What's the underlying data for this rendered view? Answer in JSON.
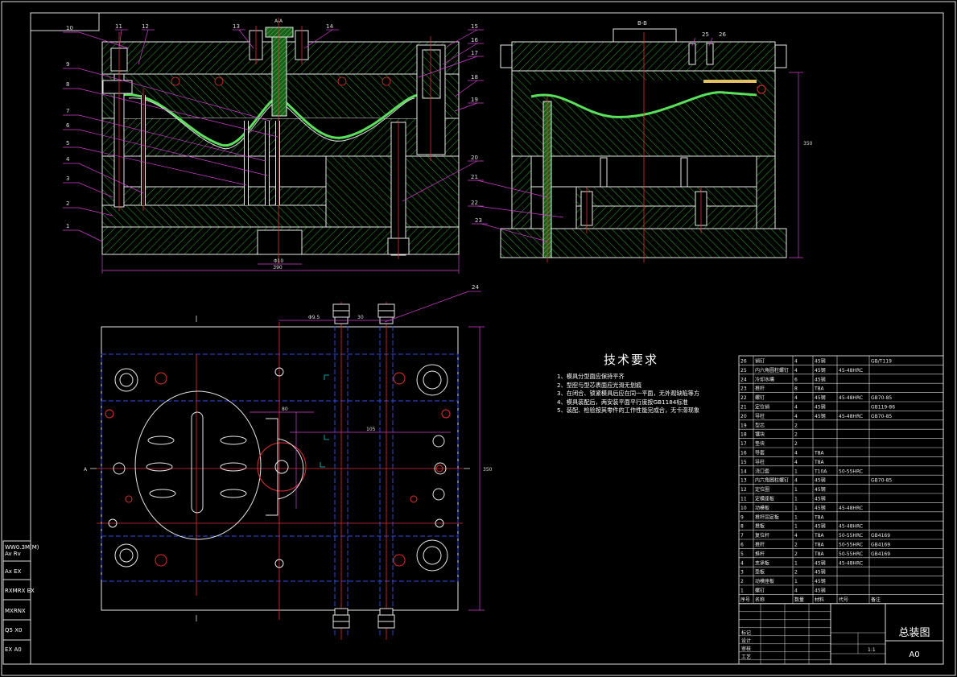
{
  "section_labels": {
    "section_a": "A-A",
    "section_b": "B-B",
    "view_a": "A"
  },
  "callouts_left": [
    "10",
    "9",
    "8",
    "7",
    "6",
    "5",
    "4",
    "3",
    "2",
    "1"
  ],
  "callouts_top": [
    "11",
    "12",
    "13",
    "14"
  ],
  "callouts_right": [
    "15",
    "16",
    "17",
    "18",
    "19",
    "20",
    "21",
    "22",
    "23"
  ],
  "callouts_bb": [
    "25",
    "26"
  ],
  "callout_plan": "24",
  "dims": {
    "overall_width": "390",
    "inner_width": "Φ10",
    "bb_height": "350",
    "plan_height": "350",
    "plan_w1": "Φ9.5",
    "plan_w2": "30",
    "plan_w3": "105",
    "plan_w4": "120",
    "plan_w5": "80"
  },
  "technical_requirements": {
    "title": "技术要求",
    "items": [
      "1、模具分型面应保持平齐",
      "2、型腔与型芯表面应光滑无划痕",
      "3、在闭合、锁紧模具后应在同一平面，无外观缺陷等方",
      "4、模具装配后，两安装平面平行度按GB1184标准",
      "5、装配、检验按其零件的工作性能完成合，无卡滞现象"
    ]
  },
  "bom": {
    "rows": [
      [
        "26",
        "销钉",
        "4",
        "45钢",
        "",
        "GB/T119"
      ],
      [
        "25",
        "内六角圆柱螺钉",
        "4",
        "45钢",
        "45-48HRC",
        ""
      ],
      [
        "24",
        "冷却水嘴",
        "6",
        "45钢",
        "",
        ""
      ],
      [
        "23",
        "推杆",
        "8",
        "T8A",
        "",
        ""
      ],
      [
        "22",
        "螺钉",
        "4",
        "45钢",
        "45-48HRC",
        "GB70-85"
      ],
      [
        "21",
        "定位销",
        "4",
        "45钢",
        "",
        "GB119-86"
      ],
      [
        "20",
        "导柱",
        "4",
        "45钢",
        "45-48HRC",
        "GB70-85"
      ],
      [
        "19",
        "型芯",
        "2",
        "",
        "",
        ""
      ],
      [
        "18",
        "镶块",
        "2",
        "",
        "",
        ""
      ],
      [
        "17",
        "垫块",
        "2",
        "",
        "",
        ""
      ],
      [
        "16",
        "导套",
        "4",
        "T8A",
        "",
        ""
      ],
      [
        "15",
        "导柱",
        "4",
        "T8A",
        "",
        ""
      ],
      [
        "14",
        "浇口套",
        "1",
        "T10A",
        "50-55HRC",
        ""
      ],
      [
        "13",
        "内六角圆柱螺钉",
        "4",
        "45钢",
        "",
        "GB70-85"
      ],
      [
        "12",
        "定位圈",
        "1",
        "45钢",
        "",
        ""
      ],
      [
        "11",
        "定模座板",
        "1",
        "45钢",
        "",
        ""
      ],
      [
        "10",
        "动模板",
        "1",
        "45钢",
        "45-48HRC",
        ""
      ],
      [
        "9",
        "推杆固定板",
        "1",
        "T8A",
        "",
        ""
      ],
      [
        "8",
        "推板",
        "1",
        "45钢",
        "45-48HRC",
        ""
      ],
      [
        "7",
        "复位杆",
        "4",
        "T8A",
        "50-55HRC",
        "GB4169"
      ],
      [
        "6",
        "推杆",
        "2",
        "T8A",
        "50-55HRC",
        "GB4169"
      ],
      [
        "5",
        "推杆",
        "2",
        "T8A",
        "50-55HRC",
        "GB4169"
      ],
      [
        "4",
        "支承板",
        "1",
        "45钢",
        "45-48HRC",
        ""
      ],
      [
        "3",
        "垫板",
        "2",
        "45钢",
        "",
        ""
      ],
      [
        "2",
        "动模座板",
        "1",
        "45钢",
        "",
        ""
      ],
      [
        "1",
        "螺钉",
        "4",
        "45钢",
        "",
        ""
      ]
    ],
    "header": [
      "序号",
      "名称",
      "数量",
      "材料",
      "代号",
      "备注"
    ]
  },
  "title_block": {
    "drawing_title": "总装图",
    "sheet_size": "A0",
    "left_labels": [
      "标记",
      "设计",
      "审核",
      "工艺"
    ],
    "scale": "1:1"
  },
  "side_labels": [
    "WW0.3M(M)",
    "Av Rv",
    "Ax EX",
    "RXMRX EX",
    "MXRNX",
    "Q5 X0",
    "EX A0"
  ]
}
